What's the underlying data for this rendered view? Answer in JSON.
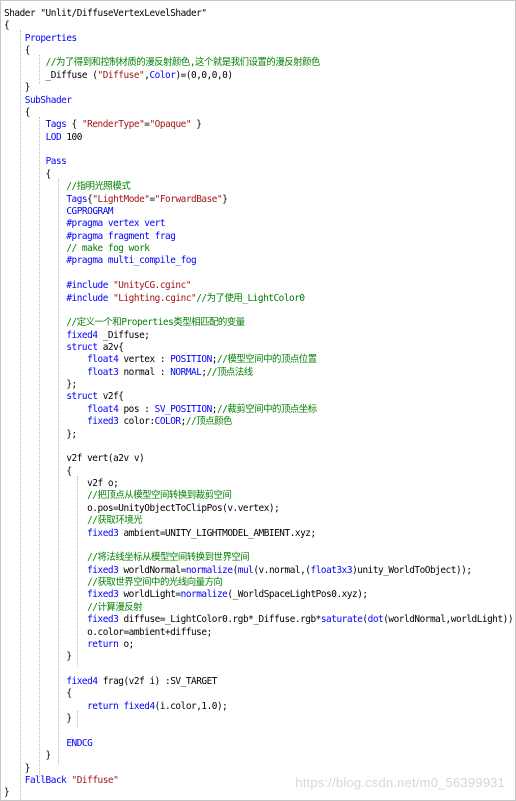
{
  "editor": {
    "lines": [
      [
        {
          "t": "Shader \"Unlit/DiffuseVertexLevelShader\"",
          "c": "tok-id"
        }
      ],
      [
        {
          "t": "{",
          "c": "tok-id"
        }
      ],
      [
        {
          "t": "    ",
          "c": "tok-id"
        },
        {
          "t": "Properties",
          "c": "tok-kw"
        }
      ],
      [
        {
          "t": "    {",
          "c": "tok-id"
        }
      ],
      [
        {
          "t": "        ",
          "c": "tok-id"
        },
        {
          "t": "//为了得到和控制材质的漫反射颜色,这个就是我们设置的漫反射颜色",
          "c": "tok-cm"
        }
      ],
      [
        {
          "t": "        _Diffuse (",
          "c": "tok-id"
        },
        {
          "t": "\"Diffuse\"",
          "c": "tok-str"
        },
        {
          "t": ",",
          "c": "tok-id"
        },
        {
          "t": "Color",
          "c": "tok-kw"
        },
        {
          "t": ")=(0,0,0,0)",
          "c": "tok-id"
        }
      ],
      [
        {
          "t": "    }",
          "c": "tok-id"
        }
      ],
      [
        {
          "t": "    ",
          "c": "tok-id"
        },
        {
          "t": "SubShader",
          "c": "tok-kw"
        }
      ],
      [
        {
          "t": "    {",
          "c": "tok-id"
        }
      ],
      [
        {
          "t": "        ",
          "c": "tok-id"
        },
        {
          "t": "Tags",
          "c": "tok-kw"
        },
        {
          "t": " { ",
          "c": "tok-id"
        },
        {
          "t": "\"RenderType\"",
          "c": "tok-str"
        },
        {
          "t": "=",
          "c": "tok-id"
        },
        {
          "t": "\"Opaque\"",
          "c": "tok-str"
        },
        {
          "t": " }",
          "c": "tok-id"
        }
      ],
      [
        {
          "t": "        ",
          "c": "tok-id"
        },
        {
          "t": "LOD",
          "c": "tok-kw"
        },
        {
          "t": " 100",
          "c": "tok-id"
        }
      ],
      [
        {
          "t": "",
          "c": "tok-id"
        }
      ],
      [
        {
          "t": "        ",
          "c": "tok-id"
        },
        {
          "t": "Pass",
          "c": "tok-kw"
        }
      ],
      [
        {
          "t": "        {",
          "c": "tok-id"
        }
      ],
      [
        {
          "t": "            ",
          "c": "tok-id"
        },
        {
          "t": "//指明光照模式",
          "c": "tok-cm"
        }
      ],
      [
        {
          "t": "            ",
          "c": "tok-id"
        },
        {
          "t": "Tags",
          "c": "tok-kw"
        },
        {
          "t": "{",
          "c": "tok-id"
        },
        {
          "t": "\"LightMode\"",
          "c": "tok-str"
        },
        {
          "t": "=",
          "c": "tok-id"
        },
        {
          "t": "\"ForwardBase\"",
          "c": "tok-str"
        },
        {
          "t": "}",
          "c": "tok-id"
        }
      ],
      [
        {
          "t": "            ",
          "c": "tok-id"
        },
        {
          "t": "CGPROGRAM",
          "c": "tok-kw"
        }
      ],
      [
        {
          "t": "            ",
          "c": "tok-id"
        },
        {
          "t": "#pragma vertex vert",
          "c": "tok-pp"
        }
      ],
      [
        {
          "t": "            ",
          "c": "tok-id"
        },
        {
          "t": "#pragma fragment frag",
          "c": "tok-pp"
        }
      ],
      [
        {
          "t": "            ",
          "c": "tok-id"
        },
        {
          "t": "// make fog work",
          "c": "tok-cm"
        }
      ],
      [
        {
          "t": "            ",
          "c": "tok-id"
        },
        {
          "t": "#pragma multi_compile_fog",
          "c": "tok-pp"
        }
      ],
      [
        {
          "t": "",
          "c": "tok-id"
        }
      ],
      [
        {
          "t": "            ",
          "c": "tok-id"
        },
        {
          "t": "#include ",
          "c": "tok-pp"
        },
        {
          "t": "\"UnityCG.cginc\"",
          "c": "tok-str"
        }
      ],
      [
        {
          "t": "            ",
          "c": "tok-id"
        },
        {
          "t": "#include ",
          "c": "tok-pp"
        },
        {
          "t": "\"Lighting.cginc\"",
          "c": "tok-str"
        },
        {
          "t": "//为了使用_LightColor0",
          "c": "tok-cm"
        }
      ],
      [
        {
          "t": "",
          "c": "tok-id"
        }
      ],
      [
        {
          "t": "            ",
          "c": "tok-id"
        },
        {
          "t": "//定义一个和Properties类型相匹配的变量",
          "c": "tok-cm"
        }
      ],
      [
        {
          "t": "            ",
          "c": "tok-id"
        },
        {
          "t": "fixed4",
          "c": "tok-kw"
        },
        {
          "t": " _Diffuse;",
          "c": "tok-id"
        }
      ],
      [
        {
          "t": "            ",
          "c": "tok-id"
        },
        {
          "t": "struct",
          "c": "tok-kw"
        },
        {
          "t": " a2v{",
          "c": "tok-id"
        }
      ],
      [
        {
          "t": "                ",
          "c": "tok-id"
        },
        {
          "t": "float4",
          "c": "tok-kw"
        },
        {
          "t": " vertex : ",
          "c": "tok-id"
        },
        {
          "t": "POSITION",
          "c": "tok-kw"
        },
        {
          "t": ";",
          "c": "tok-id"
        },
        {
          "t": "//模型空间中的顶点位置",
          "c": "tok-cm"
        }
      ],
      [
        {
          "t": "                ",
          "c": "tok-id"
        },
        {
          "t": "float3",
          "c": "tok-kw"
        },
        {
          "t": " normal : ",
          "c": "tok-id"
        },
        {
          "t": "NORMAL",
          "c": "tok-kw"
        },
        {
          "t": ";",
          "c": "tok-id"
        },
        {
          "t": "//顶点法线",
          "c": "tok-cm"
        }
      ],
      [
        {
          "t": "            };",
          "c": "tok-id"
        }
      ],
      [
        {
          "t": "            ",
          "c": "tok-id"
        },
        {
          "t": "struct",
          "c": "tok-kw"
        },
        {
          "t": " v2f{",
          "c": "tok-id"
        }
      ],
      [
        {
          "t": "                ",
          "c": "tok-id"
        },
        {
          "t": "float4",
          "c": "tok-kw"
        },
        {
          "t": " pos : ",
          "c": "tok-id"
        },
        {
          "t": "SV_POSITION",
          "c": "tok-kw"
        },
        {
          "t": ";",
          "c": "tok-id"
        },
        {
          "t": "//裁剪空间中的顶点坐标",
          "c": "tok-cm"
        }
      ],
      [
        {
          "t": "                ",
          "c": "tok-id"
        },
        {
          "t": "fixed3",
          "c": "tok-kw"
        },
        {
          "t": " color:",
          "c": "tok-id"
        },
        {
          "t": "COLOR",
          "c": "tok-kw"
        },
        {
          "t": ";",
          "c": "tok-id"
        },
        {
          "t": "//顶点颜色",
          "c": "tok-cm"
        }
      ],
      [
        {
          "t": "            };",
          "c": "tok-id"
        }
      ],
      [
        {
          "t": "",
          "c": "tok-id"
        }
      ],
      [
        {
          "t": "            v2f vert(a2v v)",
          "c": "tok-id"
        }
      ],
      [
        {
          "t": "            {",
          "c": "tok-id"
        }
      ],
      [
        {
          "t": "                v2f o;",
          "c": "tok-id"
        }
      ],
      [
        {
          "t": "                ",
          "c": "tok-id"
        },
        {
          "t": "//把顶点从模型空间转换到裁剪空间",
          "c": "tok-cm"
        }
      ],
      [
        {
          "t": "                o.pos=UnityObjectToClipPos(v.vertex);",
          "c": "tok-id"
        }
      ],
      [
        {
          "t": "                ",
          "c": "tok-id"
        },
        {
          "t": "//获取环境光",
          "c": "tok-cm"
        }
      ],
      [
        {
          "t": "                ",
          "c": "tok-id"
        },
        {
          "t": "fixed3",
          "c": "tok-kw"
        },
        {
          "t": " ambient=UNITY_LIGHTMODEL_AMBIENT.xyz;",
          "c": "tok-id"
        }
      ],
      [
        {
          "t": "",
          "c": "tok-id"
        }
      ],
      [
        {
          "t": "                ",
          "c": "tok-id"
        },
        {
          "t": "//将法线坐标从模型空间转换到世界空间",
          "c": "tok-cm"
        }
      ],
      [
        {
          "t": "                ",
          "c": "tok-id"
        },
        {
          "t": "fixed3",
          "c": "tok-kw"
        },
        {
          "t": " worldNormal=",
          "c": "tok-id"
        },
        {
          "t": "normalize",
          "c": "tok-kw"
        },
        {
          "t": "(",
          "c": "tok-id"
        },
        {
          "t": "mul",
          "c": "tok-kw"
        },
        {
          "t": "(v.normal,(",
          "c": "tok-id"
        },
        {
          "t": "float3x3",
          "c": "tok-kw"
        },
        {
          "t": ")unity_WorldToObject));",
          "c": "tok-id"
        }
      ],
      [
        {
          "t": "                ",
          "c": "tok-id"
        },
        {
          "t": "//获取世界空间中的光线向量方向",
          "c": "tok-cm"
        }
      ],
      [
        {
          "t": "                ",
          "c": "tok-id"
        },
        {
          "t": "fixed3",
          "c": "tok-kw"
        },
        {
          "t": " worldLight=",
          "c": "tok-id"
        },
        {
          "t": "normalize",
          "c": "tok-kw"
        },
        {
          "t": "(_WorldSpaceLightPos0.xyz);",
          "c": "tok-id"
        }
      ],
      [
        {
          "t": "                ",
          "c": "tok-id"
        },
        {
          "t": "//计算漫反射",
          "c": "tok-cm"
        }
      ],
      [
        {
          "t": "                ",
          "c": "tok-id"
        },
        {
          "t": "fixed3",
          "c": "tok-kw"
        },
        {
          "t": " diffuse=_LightColor0.rgb*_Diffuse.rgb*",
          "c": "tok-id"
        },
        {
          "t": "saturate",
          "c": "tok-kw"
        },
        {
          "t": "(",
          "c": "tok-id"
        },
        {
          "t": "dot",
          "c": "tok-kw"
        },
        {
          "t": "(worldNormal,worldLight));",
          "c": "tok-id"
        }
      ],
      [
        {
          "t": "                o.color=ambient+diffuse;",
          "c": "tok-id"
        }
      ],
      [
        {
          "t": "                ",
          "c": "tok-id"
        },
        {
          "t": "return",
          "c": "tok-kw"
        },
        {
          "t": " o;",
          "c": "tok-id"
        }
      ],
      [
        {
          "t": "            }",
          "c": "tok-id"
        }
      ],
      [
        {
          "t": "",
          "c": "tok-id"
        }
      ],
      [
        {
          "t": "            ",
          "c": "tok-id"
        },
        {
          "t": "fixed4",
          "c": "tok-kw"
        },
        {
          "t": " frag(v2f i) :SV_TARGET",
          "c": "tok-id"
        }
      ],
      [
        {
          "t": "            {",
          "c": "tok-id"
        }
      ],
      [
        {
          "t": "                ",
          "c": "tok-id"
        },
        {
          "t": "return",
          "c": "tok-kw"
        },
        {
          "t": " fixed4",
          "c": "tok-kw"
        },
        {
          "t": "(i.color,1.0);",
          "c": "tok-id"
        }
      ],
      [
        {
          "t": "            }",
          "c": "tok-id"
        }
      ],
      [
        {
          "t": "",
          "c": "tok-id"
        }
      ],
      [
        {
          "t": "            ",
          "c": "tok-id"
        },
        {
          "t": "ENDCG",
          "c": "tok-kw"
        }
      ],
      [
        {
          "t": "        }",
          "c": "tok-id"
        }
      ],
      [
        {
          "t": "    }",
          "c": "tok-id"
        }
      ],
      [
        {
          "t": "    ",
          "c": "tok-id"
        },
        {
          "t": "FallBack",
          "c": "tok-kw"
        },
        {
          "t": " ",
          "c": "tok-id"
        },
        {
          "t": "\"Diffuse\"",
          "c": "tok-str"
        }
      ],
      [
        {
          "t": "}",
          "c": "tok-id"
        }
      ]
    ]
  },
  "watermark": {
    "text": "https://blog.csdn.net/m0_56399931"
  },
  "colors": {
    "keyword": "#0000ff",
    "string": "#a31515",
    "comment": "#008000",
    "text": "#000000"
  }
}
